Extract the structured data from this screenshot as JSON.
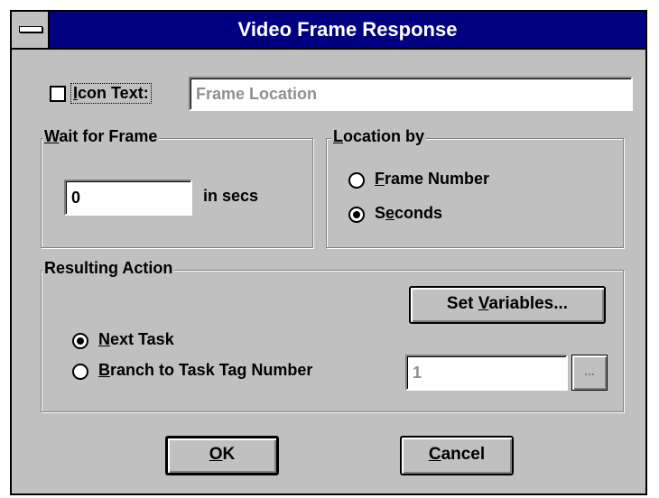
{
  "window": {
    "title": "Video Frame Response"
  },
  "icon_text": {
    "checkbox_label": "Icon Text:",
    "checked": false,
    "value": "Frame Location"
  },
  "wait_for_frame": {
    "group_label": "Wait for Frame",
    "value": "0",
    "unit": "in secs"
  },
  "location_by": {
    "group_label": "Location by",
    "options": [
      {
        "label": "Frame Number",
        "selected": false
      },
      {
        "label": "Seconds",
        "selected": true
      }
    ]
  },
  "resulting_action": {
    "group_label": "Resulting Action",
    "set_variables_label": "Set Variables...",
    "options": [
      {
        "label": "Next Task",
        "selected": true
      },
      {
        "label": "Branch to Task Tag Number",
        "selected": false
      }
    ],
    "tag_number": "1",
    "browse_label": "..."
  },
  "buttons": {
    "ok_label": "OK",
    "cancel_label": "Cancel"
  }
}
